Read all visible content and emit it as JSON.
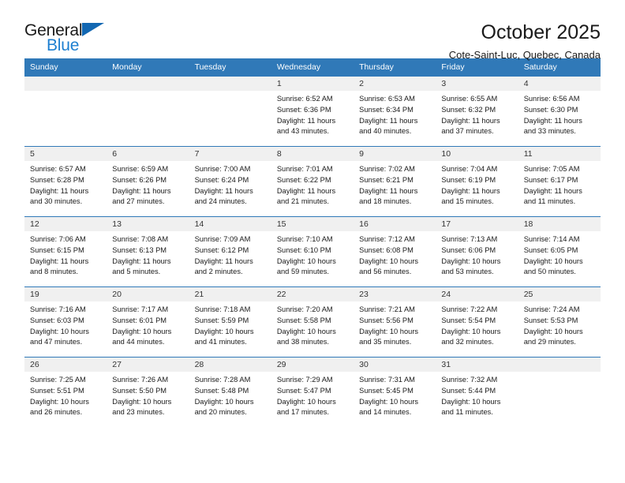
{
  "logo": {
    "line1": "General",
    "line2": "Blue",
    "triangle_color": "#1267b2",
    "blue_color": "#1d7fd0"
  },
  "header": {
    "title": "October 2025",
    "location": "Cote-Saint-Luc, Quebec, Canada"
  },
  "theme": {
    "header_blue": "#3079b8",
    "daynum_bg": "#f0f0f0"
  },
  "weekdays": [
    "Sunday",
    "Monday",
    "Tuesday",
    "Wednesday",
    "Thursday",
    "Friday",
    "Saturday"
  ],
  "labels": {
    "sunrise": "Sunrise:",
    "sunset": "Sunset:",
    "daylight": "Daylight:"
  },
  "weeks": [
    [
      {
        "day": "",
        "empty": true
      },
      {
        "day": "",
        "empty": true
      },
      {
        "day": "",
        "empty": true
      },
      {
        "day": "1",
        "sunrise": "Sunrise: 6:52 AM",
        "sunset": "Sunset: 6:36 PM",
        "daylight": "Daylight: 11 hours and 43 minutes."
      },
      {
        "day": "2",
        "sunrise": "Sunrise: 6:53 AM",
        "sunset": "Sunset: 6:34 PM",
        "daylight": "Daylight: 11 hours and 40 minutes."
      },
      {
        "day": "3",
        "sunrise": "Sunrise: 6:55 AM",
        "sunset": "Sunset: 6:32 PM",
        "daylight": "Daylight: 11 hours and 37 minutes."
      },
      {
        "day": "4",
        "sunrise": "Sunrise: 6:56 AM",
        "sunset": "Sunset: 6:30 PM",
        "daylight": "Daylight: 11 hours and 33 minutes."
      }
    ],
    [
      {
        "day": "5",
        "sunrise": "Sunrise: 6:57 AM",
        "sunset": "Sunset: 6:28 PM",
        "daylight": "Daylight: 11 hours and 30 minutes."
      },
      {
        "day": "6",
        "sunrise": "Sunrise: 6:59 AM",
        "sunset": "Sunset: 6:26 PM",
        "daylight": "Daylight: 11 hours and 27 minutes."
      },
      {
        "day": "7",
        "sunrise": "Sunrise: 7:00 AM",
        "sunset": "Sunset: 6:24 PM",
        "daylight": "Daylight: 11 hours and 24 minutes."
      },
      {
        "day": "8",
        "sunrise": "Sunrise: 7:01 AM",
        "sunset": "Sunset: 6:22 PM",
        "daylight": "Daylight: 11 hours and 21 minutes."
      },
      {
        "day": "9",
        "sunrise": "Sunrise: 7:02 AM",
        "sunset": "Sunset: 6:21 PM",
        "daylight": "Daylight: 11 hours and 18 minutes."
      },
      {
        "day": "10",
        "sunrise": "Sunrise: 7:04 AM",
        "sunset": "Sunset: 6:19 PM",
        "daylight": "Daylight: 11 hours and 15 minutes."
      },
      {
        "day": "11",
        "sunrise": "Sunrise: 7:05 AM",
        "sunset": "Sunset: 6:17 PM",
        "daylight": "Daylight: 11 hours and 11 minutes."
      }
    ],
    [
      {
        "day": "12",
        "sunrise": "Sunrise: 7:06 AM",
        "sunset": "Sunset: 6:15 PM",
        "daylight": "Daylight: 11 hours and 8 minutes."
      },
      {
        "day": "13",
        "sunrise": "Sunrise: 7:08 AM",
        "sunset": "Sunset: 6:13 PM",
        "daylight": "Daylight: 11 hours and 5 minutes."
      },
      {
        "day": "14",
        "sunrise": "Sunrise: 7:09 AM",
        "sunset": "Sunset: 6:12 PM",
        "daylight": "Daylight: 11 hours and 2 minutes."
      },
      {
        "day": "15",
        "sunrise": "Sunrise: 7:10 AM",
        "sunset": "Sunset: 6:10 PM",
        "daylight": "Daylight: 10 hours and 59 minutes."
      },
      {
        "day": "16",
        "sunrise": "Sunrise: 7:12 AM",
        "sunset": "Sunset: 6:08 PM",
        "daylight": "Daylight: 10 hours and 56 minutes."
      },
      {
        "day": "17",
        "sunrise": "Sunrise: 7:13 AM",
        "sunset": "Sunset: 6:06 PM",
        "daylight": "Daylight: 10 hours and 53 minutes."
      },
      {
        "day": "18",
        "sunrise": "Sunrise: 7:14 AM",
        "sunset": "Sunset: 6:05 PM",
        "daylight": "Daylight: 10 hours and 50 minutes."
      }
    ],
    [
      {
        "day": "19",
        "sunrise": "Sunrise: 7:16 AM",
        "sunset": "Sunset: 6:03 PM",
        "daylight": "Daylight: 10 hours and 47 minutes."
      },
      {
        "day": "20",
        "sunrise": "Sunrise: 7:17 AM",
        "sunset": "Sunset: 6:01 PM",
        "daylight": "Daylight: 10 hours and 44 minutes."
      },
      {
        "day": "21",
        "sunrise": "Sunrise: 7:18 AM",
        "sunset": "Sunset: 5:59 PM",
        "daylight": "Daylight: 10 hours and 41 minutes."
      },
      {
        "day": "22",
        "sunrise": "Sunrise: 7:20 AM",
        "sunset": "Sunset: 5:58 PM",
        "daylight": "Daylight: 10 hours and 38 minutes."
      },
      {
        "day": "23",
        "sunrise": "Sunrise: 7:21 AM",
        "sunset": "Sunset: 5:56 PM",
        "daylight": "Daylight: 10 hours and 35 minutes."
      },
      {
        "day": "24",
        "sunrise": "Sunrise: 7:22 AM",
        "sunset": "Sunset: 5:54 PM",
        "daylight": "Daylight: 10 hours and 32 minutes."
      },
      {
        "day": "25",
        "sunrise": "Sunrise: 7:24 AM",
        "sunset": "Sunset: 5:53 PM",
        "daylight": "Daylight: 10 hours and 29 minutes."
      }
    ],
    [
      {
        "day": "26",
        "sunrise": "Sunrise: 7:25 AM",
        "sunset": "Sunset: 5:51 PM",
        "daylight": "Daylight: 10 hours and 26 minutes."
      },
      {
        "day": "27",
        "sunrise": "Sunrise: 7:26 AM",
        "sunset": "Sunset: 5:50 PM",
        "daylight": "Daylight: 10 hours and 23 minutes."
      },
      {
        "day": "28",
        "sunrise": "Sunrise: 7:28 AM",
        "sunset": "Sunset: 5:48 PM",
        "daylight": "Daylight: 10 hours and 20 minutes."
      },
      {
        "day": "29",
        "sunrise": "Sunrise: 7:29 AM",
        "sunset": "Sunset: 5:47 PM",
        "daylight": "Daylight: 10 hours and 17 minutes."
      },
      {
        "day": "30",
        "sunrise": "Sunrise: 7:31 AM",
        "sunset": "Sunset: 5:45 PM",
        "daylight": "Daylight: 10 hours and 14 minutes."
      },
      {
        "day": "31",
        "sunrise": "Sunrise: 7:32 AM",
        "sunset": "Sunset: 5:44 PM",
        "daylight": "Daylight: 10 hours and 11 minutes."
      },
      {
        "day": "",
        "empty": true
      }
    ]
  ]
}
